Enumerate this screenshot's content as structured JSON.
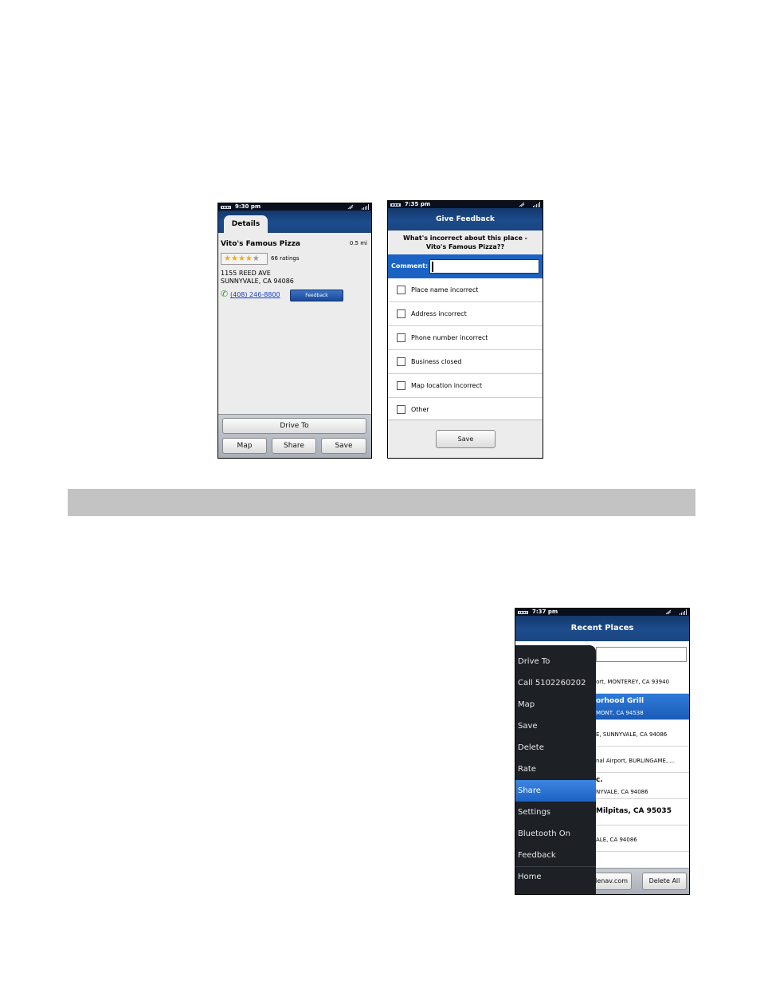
{
  "screen1": {
    "status_time": "9:30 pm",
    "tab": "Details",
    "place_name": "Vito's Famous Pizza",
    "distance": "0.5 mi",
    "rating_stars": 4,
    "rating_max": 5,
    "ratings_count": "66 ratings",
    "address_line1": "1155 REED AVE",
    "address_line2": "SUNNYVALE, CA 94086",
    "phone": "(408) 246-8800",
    "feedback_label": "Feedback",
    "drive_to": "Drive To",
    "map": "Map",
    "share": "Share",
    "save": "Save"
  },
  "screen2": {
    "status_time": "7:35 pm",
    "title": "Give Feedback",
    "question_line1": "What's incorrect about this place -",
    "question_line2": "Vito's Famous Pizza??",
    "comment_label": "Comment:",
    "options": [
      "Place name incorrect",
      "Address incorrect",
      "Phone number incorrect",
      "Business closed",
      "Map location incorrect",
      "Other"
    ],
    "save": "Save"
  },
  "screen3": {
    "status_time": "7:37 pm",
    "title": "Recent Places",
    "rows": [
      {
        "title": "",
        "sub": "ort, MONTEREY, CA 93940"
      },
      {
        "title": "orhood Grill",
        "sub": "MONT, CA 94538"
      },
      {
        "title": "",
        "sub": "E, SUNNYVALE, CA 94086"
      },
      {
        "title": "",
        "sub": "nal Airport, BURLINGAME, ..."
      },
      {
        "title": "c.",
        "sub": "NYVALE, CA 94086"
      },
      {
        "title": "Milpitas, CA 95035",
        "sub": ""
      },
      {
        "title": "",
        "sub": "ALE, CA 94086"
      }
    ],
    "url_button": "lenav.com",
    "delete_all": "Delete All",
    "menu": [
      "Drive To",
      "Call 5102260202",
      "Map",
      "Save",
      "Delete",
      "Rate",
      "Share",
      "Settings",
      "Bluetooth On",
      "Feedback",
      "Home"
    ],
    "menu_active": "Share"
  },
  "colors": {
    "navbar": "#1d4c8c",
    "highlight": "#1d62c4",
    "menu_bg": "#1d2024",
    "link": "#1a3fc2"
  }
}
